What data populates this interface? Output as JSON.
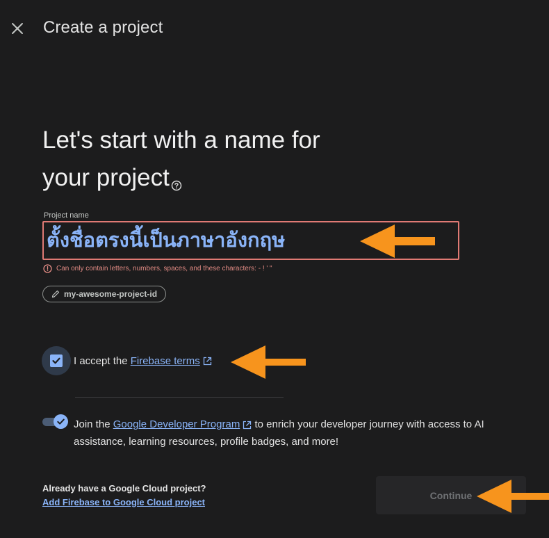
{
  "header": {
    "title": "Create a project",
    "close_icon": "close-icon"
  },
  "main": {
    "headline_line1": "Let's start with a name for",
    "headline_line2": "your project",
    "help_icon": "help-circle-icon",
    "project_name": {
      "label": "Project name",
      "value": "ตั้งชื่อตรงนี้เป็นภาษาอังกฤษ",
      "error": "Can only contain letters, numbers, spaces, and these characters: - ! ' \""
    },
    "project_id_chip": "my-awesome-project-id",
    "terms": {
      "checked": true,
      "prefix": "I accept the ",
      "link": "Firebase terms"
    },
    "gdp": {
      "enabled": true,
      "prefix": "Join the ",
      "link": "Google Developer Program",
      "suffix": " to enrich your developer journey with access to AI assistance, learning resources, profile badges, and more!"
    }
  },
  "footer": {
    "cloud_question": "Already have a Google Cloud project?",
    "cloud_link": "Add Firebase to Google Cloud project",
    "continue_label": "Continue"
  },
  "colors": {
    "background": "#1c1c1d",
    "accent": "#8ab4f8",
    "error": "#e28b84",
    "annotation_arrow": "#f7941d"
  }
}
